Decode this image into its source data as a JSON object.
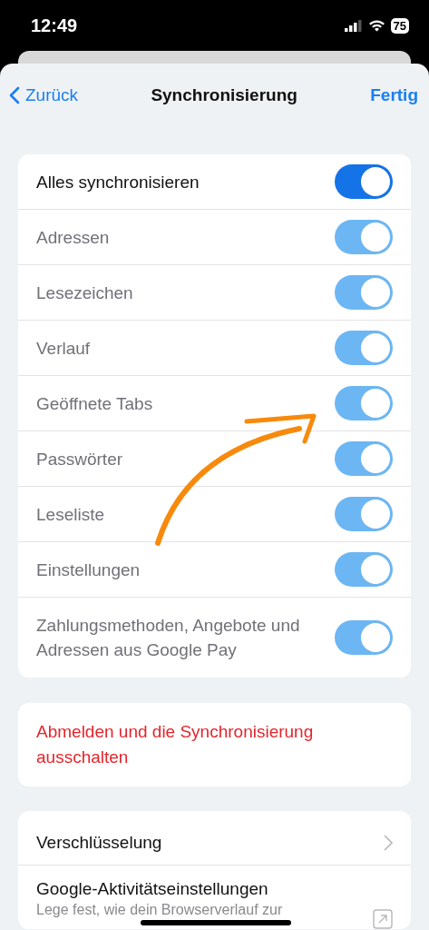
{
  "status_bar": {
    "time": "12:49",
    "battery": "75"
  },
  "nav": {
    "back": "Zurück",
    "title": "Synchronisierung",
    "done": "Fertig"
  },
  "sync_items": [
    {
      "label": "Alles synchronisieren",
      "on": true,
      "disabled": false
    },
    {
      "label": "Adressen",
      "on": true,
      "disabled": true
    },
    {
      "label": "Lesezeichen",
      "on": true,
      "disabled": true
    },
    {
      "label": "Verlauf",
      "on": true,
      "disabled": true
    },
    {
      "label": "Geöffnete Tabs",
      "on": true,
      "disabled": true
    },
    {
      "label": "Passwörter",
      "on": true,
      "disabled": true
    },
    {
      "label": "Leseliste",
      "on": true,
      "disabled": true
    },
    {
      "label": "Einstellungen",
      "on": true,
      "disabled": true
    },
    {
      "label": "Zahlungsmethoden, Angebote und Adressen aus Google Pay",
      "on": true,
      "disabled": true
    }
  ],
  "sign_out": "Abmelden und die Synchronisierung ausschalten",
  "more": [
    {
      "kind": "chevron",
      "label": "Verschlüsselung"
    },
    {
      "kind": "external",
      "label": "Google-Aktivitätseinstellungen",
      "description": "Lege fest, wie dein Browserverlauf zur"
    }
  ]
}
